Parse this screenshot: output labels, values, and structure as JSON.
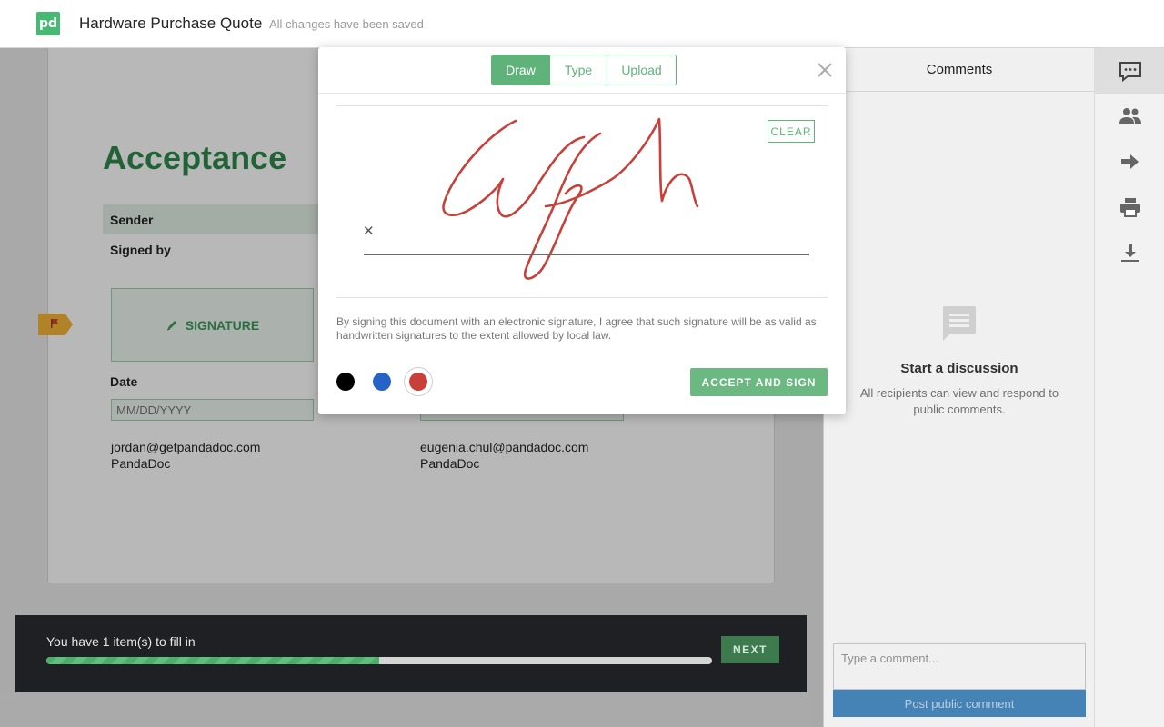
{
  "header": {
    "logo_text": "pd",
    "title": "Hardware Purchase Quote",
    "save_status": "All changes have been saved"
  },
  "document": {
    "section_title": "Acceptance",
    "sender_label": "Sender",
    "signed_by_label": "Signed by",
    "signature_field_label": "SIGNATURE",
    "date_label": "Date",
    "date_placeholder": "MM/DD/YYYY",
    "signer_1": {
      "email": "jordan@getpandadoc.com",
      "company": "PandaDoc"
    },
    "signer_2": {
      "email": "eugenia.chul@pandadoc.com",
      "company": "PandaDoc"
    }
  },
  "fill_bar": {
    "text": "You have 1 item(s) to fill in",
    "progress_percent": 50,
    "next_label": "NEXT"
  },
  "comments": {
    "header": "Comments",
    "empty_title": "Start a discussion",
    "empty_text": "All recipients can view and respond to public comments.",
    "input_placeholder": "Type a comment...",
    "post_label": "Post public comment"
  },
  "toolbar": {
    "icons": [
      "comments-icon",
      "people-icon",
      "arrow-right-icon",
      "print-icon",
      "download-icon"
    ],
    "active": "comments-icon"
  },
  "signature_modal": {
    "tabs": [
      {
        "label": "Draw",
        "active": true
      },
      {
        "label": "Type",
        "active": false
      },
      {
        "label": "Upload",
        "active": false
      }
    ],
    "clear_label": "CLEAR",
    "sign_marker": "✕",
    "disclaimer": "By signing this document with an electronic signature, I agree that such signature will be as valid as handwritten signatures to the extent allowed by local law.",
    "colors": [
      "#000000",
      "#2563c7",
      "#c8403a"
    ],
    "selected_color": "#c8403a",
    "accept_label": "ACCEPT AND SIGN"
  }
}
